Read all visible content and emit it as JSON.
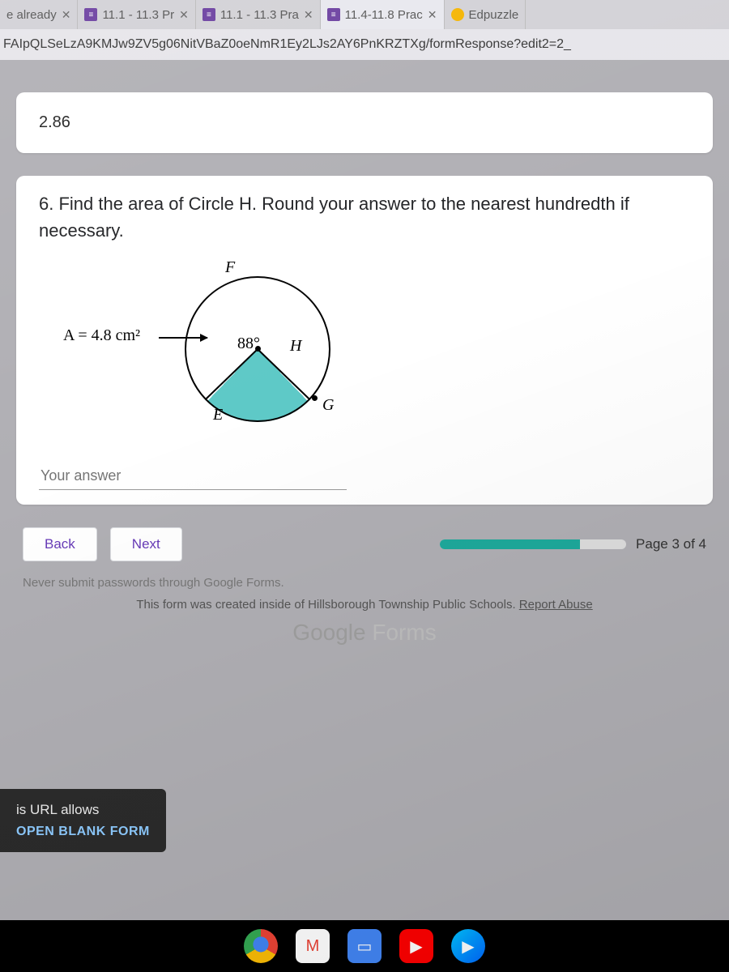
{
  "tabs": [
    {
      "label": "e already",
      "icon": ""
    },
    {
      "label": "11.1 - 11.3 Pr",
      "icon": "forms"
    },
    {
      "label": "11.1 - 11.3 Pra",
      "icon": "forms"
    },
    {
      "label": "11.4-11.8 Prac",
      "icon": "forms"
    },
    {
      "label": "Edpuzzle",
      "icon": "edpuzzle"
    }
  ],
  "url": "FAIpQLSeLzA9KMJw9ZV5g06NitVBaZ0oeNmR1Ey2LJs2AY6PnKRZTXg/formResponse?edit2=2_",
  "prev_answer": "2.86",
  "question": "6. Find the area of Circle H. Round your answer to the nearest hundredth if necessary.",
  "diagram": {
    "area_label": "A = 4.8 cm²",
    "angle": "88°",
    "F": "F",
    "E": "E",
    "G": "G",
    "H": "H"
  },
  "answer_placeholder": "Your answer",
  "nav": {
    "back": "Back",
    "next": "Next",
    "page": "Page 3 of 4",
    "progress_pct": 75
  },
  "disclaimer": "Never submit passwords through Google Forms.",
  "footer": {
    "org_line_pre": "This form was created inside of ",
    "org": "Hillsborough Township Public Schools.",
    "report": "Report Abuse",
    "product": "Google Forms"
  },
  "snackbar": {
    "msg": "is URL allows",
    "action": "OPEN BLANK FORM"
  }
}
